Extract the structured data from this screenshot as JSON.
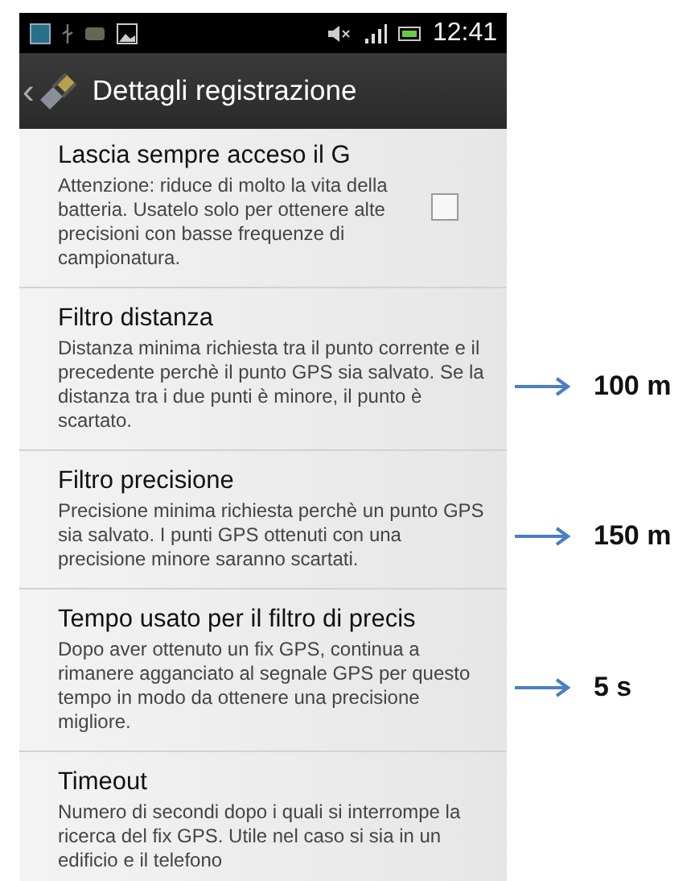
{
  "status_bar": {
    "time": "12:41"
  },
  "action_bar": {
    "back": "‹",
    "title": "Dettagli registrazione"
  },
  "settings": [
    {
      "kind": "checkbox",
      "title": "Lascia sempre acceso il G",
      "description": "Attenzione: riduce di molto la vita della batteria. Usatelo solo per ottenere alte precisioni con basse frequenze di campionatura.",
      "checked": false
    },
    {
      "kind": "plain",
      "title": "Filtro distanza",
      "description": "Distanza minima richiesta tra il punto corrente e il precedente perchè il punto GPS sia salvato. Se la distanza tra i due punti è minore, il punto è scartato.",
      "annotation": "100 m"
    },
    {
      "kind": "plain",
      "title": "Filtro precisione",
      "description": "Precisione minima richiesta perchè un punto GPS sia salvato. I punti GPS ottenuti con una precisione minore saranno scartati.",
      "annotation": "150 m"
    },
    {
      "kind": "plain",
      "title": "Tempo usato per il filtro di precis",
      "description": "Dopo aver ottenuto un fix GPS, continua a rimanere agganciato al segnale GPS per questo tempo in modo da ottenere una precisione migliore.",
      "annotation": "5 s"
    },
    {
      "kind": "plain",
      "title": "Timeout",
      "description": "Numero di secondi dopo i quali si interrompe la ricerca del fix GPS. Utile nel caso si sia in un edificio e il telefono"
    }
  ]
}
